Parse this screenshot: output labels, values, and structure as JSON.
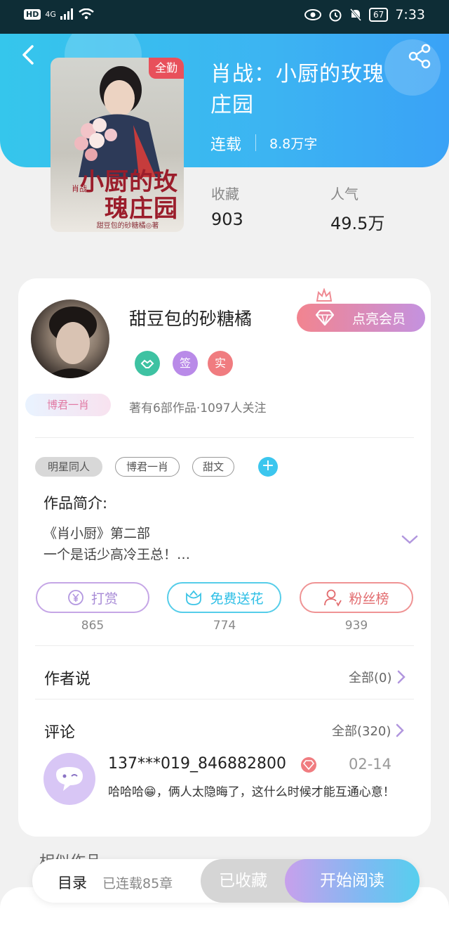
{
  "status_bar": {
    "hd": "HD",
    "signal": "4G",
    "battery": "67",
    "time": "7:33"
  },
  "book": {
    "cover_badge": "全勤",
    "cover_title_small": "肖战",
    "cover_title": "小厨的玫瑰庄园",
    "cover_author": "甜豆包的砂糖橘◎著",
    "title_line1": "肖战：小厨的玫瑰",
    "title_line2": "庄园",
    "status": "连载",
    "word_count": "8.8万字",
    "stats": [
      {
        "label": "收藏",
        "value": "903"
      },
      {
        "label": "人气",
        "value": "49.5万"
      }
    ]
  },
  "author": {
    "name": "甜豆包的砂糖橘",
    "vip_button": "点亮会员",
    "badges": [
      "签",
      "实"
    ],
    "fan_tag": "博君一肖",
    "stats": "著有6部作品·1097人关注"
  },
  "tags": [
    "明星同人",
    "博君一肖",
    "甜文"
  ],
  "tag_add": "+",
  "intro": {
    "title": "作品简介:",
    "line1": "《肖小厨》第二部",
    "line2": "一个是话少高冷王总！…"
  },
  "actions": [
    {
      "label": "打赏",
      "icon": "yen-icon",
      "count": "865"
    },
    {
      "label": "免费送花",
      "icon": "flower-icon",
      "count": "774"
    },
    {
      "label": "粉丝榜",
      "icon": "fans-icon",
      "count": "939"
    }
  ],
  "author_says": {
    "title": "作者说",
    "more": "全部(0)"
  },
  "comments": {
    "title": "评论",
    "more": "全部(320)",
    "items": [
      {
        "user": "137***019_846882800",
        "date": "02-14",
        "text": "哈哈哈😁，俩人太隐晦了，这什么时候才能互通心意！"
      }
    ]
  },
  "similar": {
    "title": "相似作品"
  },
  "bottom_bar": {
    "toc": "目录",
    "chapters": "已连载85章",
    "collected": "已收藏",
    "read": "开始阅读"
  },
  "colors": {
    "header_start": "#35c6ec",
    "header_end": "#3aa2f6",
    "accent_cyan": "#3cc6ee",
    "accent_purple": "#a78ad6",
    "accent_red": "#e26b6e"
  }
}
